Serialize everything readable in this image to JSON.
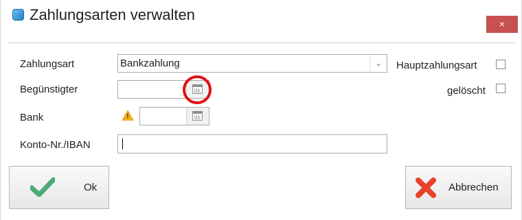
{
  "window": {
    "title": "Zahlungsarten verwalten",
    "close_symbol": "×"
  },
  "form": {
    "zahlungsart": {
      "label": "Zahlungsart",
      "value": "Bankzahlung",
      "dropdown_symbol": "⌄"
    },
    "beguenstigter": {
      "label": "Begünstigter",
      "value": ""
    },
    "bank": {
      "label": "Bank",
      "value": "",
      "warning_symbol": "!"
    },
    "konto": {
      "label": "Konto-Nr./IBAN",
      "value": ""
    },
    "hauptzahlungsart": {
      "label": "Hauptzahlungsart",
      "checked": false
    },
    "geloescht": {
      "label": "gelöscht",
      "checked": false
    }
  },
  "buttons": {
    "ok_label": "Ok",
    "cancel_label": "Abbrechen"
  },
  "colors": {
    "close": "#c75050",
    "highlight": "#e01010",
    "check": "#4bab74",
    "cancel_x": "#e8412b",
    "warning": "#f0b020"
  }
}
